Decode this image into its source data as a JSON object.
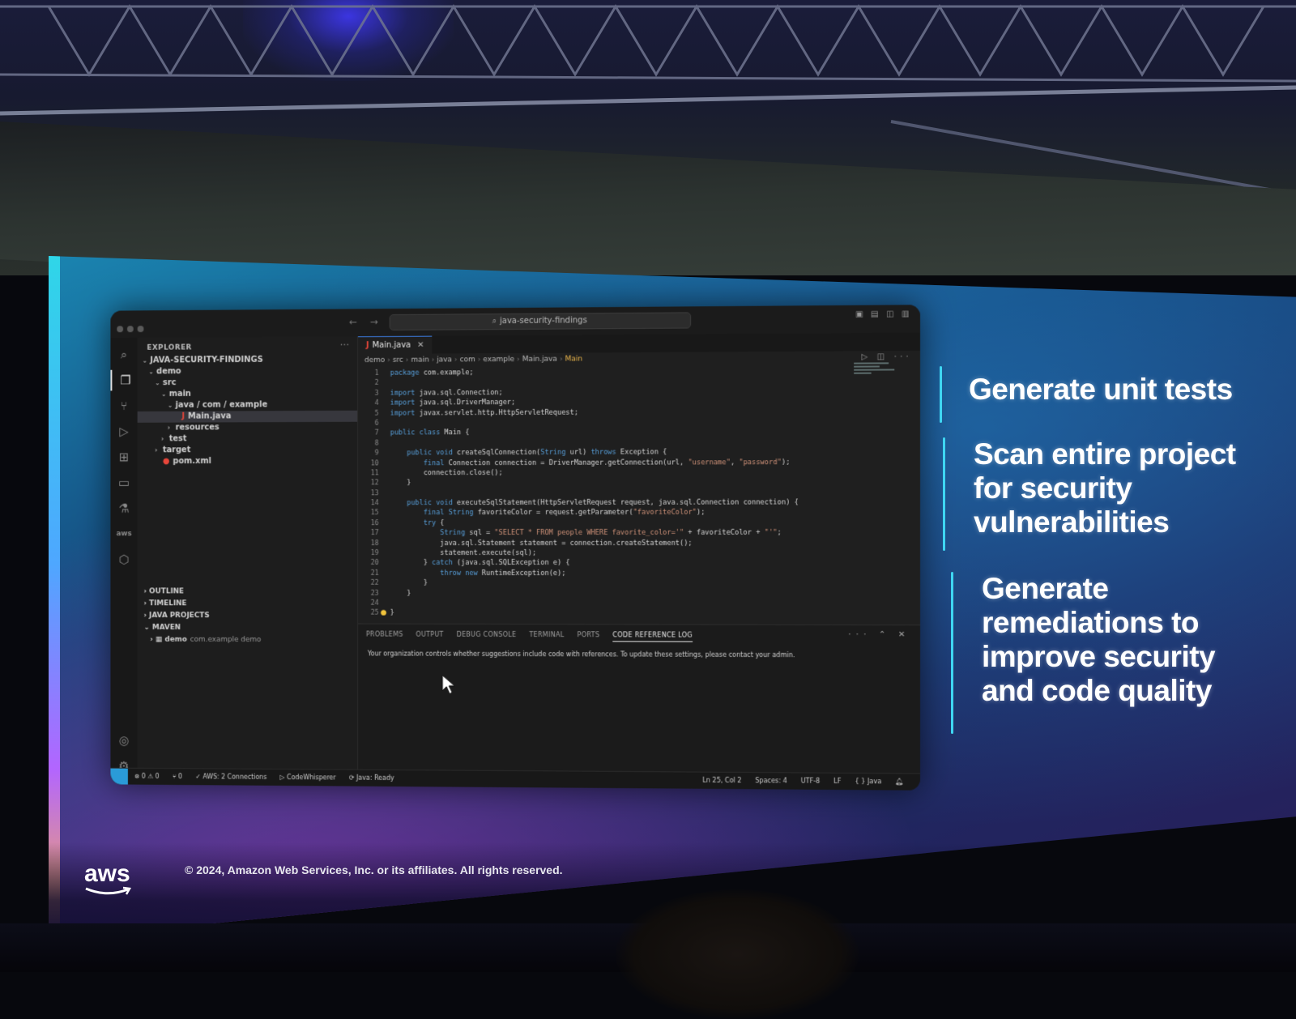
{
  "ide": {
    "search_text": "java-security-findings",
    "activity_icons": [
      "search-icon",
      "explorer-icon",
      "source-control-icon",
      "run-debug-icon",
      "extensions-icon",
      "remote-explorer-icon",
      "testing-icon",
      "aws-icon",
      "security-icon"
    ],
    "sidebar": {
      "heading": "EXPLORER",
      "tree": [
        {
          "label": "JAVA-SECURITY-FINDINGS",
          "twisty": "⌄",
          "indent": 0
        },
        {
          "label": "demo",
          "twisty": "⌄",
          "indent": 1
        },
        {
          "label": "src",
          "twisty": "⌄",
          "indent": 2
        },
        {
          "label": "main",
          "twisty": "⌄",
          "indent": 3
        },
        {
          "label": "java / com / example",
          "twisty": "⌄",
          "indent": 4
        },
        {
          "label": "Main.java",
          "twisty": "",
          "indent": 5,
          "selected": true,
          "file_icon": "J"
        },
        {
          "label": "resources",
          "twisty": "›",
          "indent": 4
        },
        {
          "label": "test",
          "twisty": "›",
          "indent": 3
        },
        {
          "label": "target",
          "twisty": "›",
          "indent": 2
        },
        {
          "label": "pom.xml",
          "twisty": "",
          "indent": 2,
          "file_icon": "xml"
        }
      ],
      "sections": [
        {
          "label": "OUTLINE",
          "twisty": "›"
        },
        {
          "label": "TIMELINE",
          "twisty": "›"
        },
        {
          "label": "JAVA PROJECTS",
          "twisty": "›"
        },
        {
          "label": "MAVEN",
          "twisty": "⌄"
        }
      ],
      "maven_item": {
        "label": "demo",
        "detail": "com.example demo"
      }
    },
    "tab": {
      "label": "Main.java"
    },
    "breadcrumb": [
      "demo",
      "src",
      "main",
      "java",
      "com",
      "example",
      "Main.java",
      "Main"
    ],
    "code": [
      "package com.example;",
      "",
      "import java.sql.Connection;",
      "import java.sql.DriverManager;",
      "import javax.servlet.http.HttpServletRequest;",
      "",
      "public class Main {",
      "",
      "    public void createSqlConnection(String url) throws Exception {",
      "        final Connection connection = DriverManager.getConnection(url, \"username\", \"password\");",
      "        connection.close();",
      "    }",
      "",
      "    public void executeSqlStatement(HttpServletRequest request, java.sql.Connection connection) {",
      "        final String favoriteColor = request.getParameter(\"favoriteColor\");",
      "        try {",
      "            String sql = \"SELECT * FROM people WHERE favorite_color='\" + favoriteColor + \"'\";",
      "            java.sql.Statement statement = connection.createStatement();",
      "            statement.execute(sql);",
      "        } catch (java.sql.SQLException e) {",
      "            throw new RuntimeException(e);",
      "        }",
      "    }",
      "",
      "}"
    ],
    "panel": {
      "tabs": [
        "PROBLEMS",
        "OUTPUT",
        "DEBUG CONSOLE",
        "TERMINAL",
        "PORTS",
        "CODE REFERENCE LOG"
      ],
      "active_tab": "CODE REFERENCE LOG",
      "message": "Your organization controls whether suggestions include code with references. To update these settings, please contact your admin."
    },
    "status": {
      "problems": "⊗ 0 ⚠ 0",
      "ports": "⑂ 0",
      "aws": "✓ AWS: 2 Connections",
      "codewhisperer": "▷ CodeWhisperer",
      "java": "⟳ Java: Ready",
      "position": "Ln 25, Col 2",
      "spaces": "Spaces: 4",
      "encoding": "UTF-8",
      "eol": "LF",
      "language": "{ } Java"
    }
  },
  "slide": {
    "points": [
      "Generate unit tests",
      "Scan entire project for security vulnerabilities",
      "Generate remediations to improve security and code quality"
    ],
    "logo": "aws",
    "copyright": "© 2024, Amazon Web Services, Inc. or its affiliates. All rights reserved."
  },
  "colors": {
    "accent_bar": "#3fd6f2",
    "ide_bg": "#1e1e1e",
    "keyword": "#569cd6",
    "string": "#ce9178"
  }
}
